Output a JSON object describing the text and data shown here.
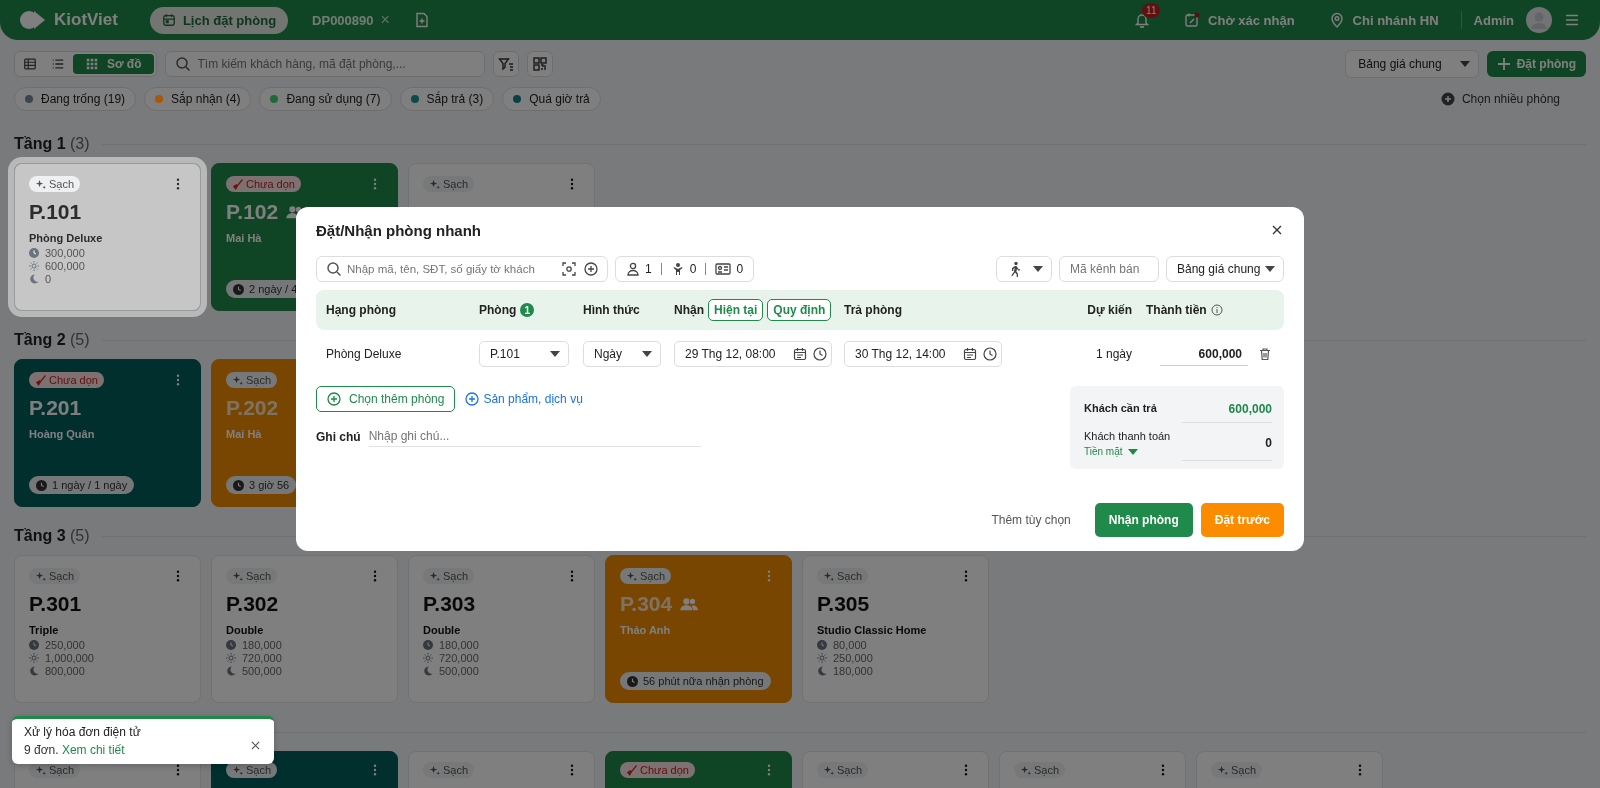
{
  "header": {
    "logo": "KiotViet",
    "tabs": [
      {
        "label": "Lịch đặt phòng",
        "kind": "calendar",
        "selected": true
      },
      {
        "label": "DP000890",
        "kind": "closable",
        "close": "×",
        "selected": false
      }
    ],
    "notification_count": "11",
    "pending": "Chờ xác nhận",
    "branch": "Chi nhánh HN",
    "user": "Admin"
  },
  "toolbar": {
    "views": [
      {
        "kind": "table",
        "selected": false
      },
      {
        "kind": "list",
        "selected": false
      },
      {
        "kind": "grid",
        "label": "Sơ đồ",
        "selected": true
      }
    ],
    "search": {
      "placeholder": "Tìm kiếm khách hàng, mã đặt phòng,..."
    },
    "price_list": "Bảng giá chung",
    "add_button": "Đặt phòng"
  },
  "filters": [
    {
      "label": "Đang trống (19)",
      "color": "#3d4450"
    },
    {
      "label": "Sắp nhận (4)",
      "color": "#a8580a"
    },
    {
      "label": "Đang sử dụng (7)",
      "color": "#1d6b3a"
    },
    {
      "label": "Sắp trả (3)",
      "color": "#0e4a4a"
    },
    {
      "label": "Quá giờ trả",
      "color": "#0b3f44"
    }
  ],
  "multi_select": "Chọn nhiều phòng",
  "floors": [
    {
      "name": "Tầng 1",
      "count": "(3)",
      "rooms": [
        {
          "kind": "vacant",
          "selected": true,
          "status": {
            "kind": "clean",
            "label": "Sạch"
          },
          "code": "P.101",
          "guests": false,
          "name": "Phòng Deluxe",
          "prices": [
            {
              "kind": "hour",
              "value": "300,000"
            },
            {
              "kind": "day",
              "value": "600,000"
            },
            {
              "kind": "night",
              "value": "0"
            }
          ]
        },
        {
          "kind": "occupied",
          "selected": false,
          "status": {
            "kind": "dirty",
            "label": "Chưa dọn"
          },
          "code": "P.102",
          "guests": true,
          "name": "Mai Hà",
          "pill": "2 ngày / 4"
        },
        {
          "kind": "vacant",
          "selected": false,
          "status": {
            "kind": "clean",
            "label": "Sạch"
          }
        }
      ]
    },
    {
      "name": "Tầng 2",
      "count": "(5)",
      "rooms": [
        {
          "kind": "checkout",
          "selected": false,
          "status": {
            "kind": "dirty",
            "label": "Chưa dọn"
          },
          "code": "P.201",
          "guests": false,
          "name": "Hoàng Quân",
          "pill": "1 ngày / 1 ngày"
        },
        {
          "kind": "arriving",
          "selected": false,
          "status": {
            "kind": "clean",
            "label": "Sạch"
          },
          "code": "P.202",
          "guests": false,
          "name": "Mai Hà",
          "pill": "3 giờ 56"
        }
      ]
    },
    {
      "name": "Tầng 3",
      "count": "(5)",
      "rooms": [
        {
          "kind": "vacant",
          "selected": false,
          "status": {
            "kind": "clean",
            "label": "Sạch"
          },
          "code": "P.301",
          "guests": false,
          "name": "Triple",
          "prices": [
            {
              "kind": "hour",
              "value": "250,000"
            },
            {
              "kind": "day",
              "value": "1,000,000"
            },
            {
              "kind": "night",
              "value": "800,000"
            }
          ]
        },
        {
          "kind": "vacant",
          "selected": false,
          "status": {
            "kind": "clean",
            "label": "Sạch"
          },
          "code": "P.302",
          "guests": false,
          "name": "Double",
          "prices": [
            {
              "kind": "hour",
              "value": "180,000"
            },
            {
              "kind": "day",
              "value": "720,000"
            },
            {
              "kind": "night",
              "value": "500,000"
            }
          ]
        },
        {
          "kind": "vacant",
          "selected": false,
          "status": {
            "kind": "clean",
            "label": "Sạch"
          },
          "code": "P.303",
          "guests": false,
          "name": "Double",
          "prices": [
            {
              "kind": "hour",
              "value": "180,000"
            },
            {
              "kind": "day",
              "value": "720,000"
            },
            {
              "kind": "night",
              "value": "500,000"
            }
          ]
        },
        {
          "kind": "arriving",
          "selected": false,
          "status": {
            "kind": "clean",
            "label": "Sạch"
          },
          "code": "P.304",
          "guests": true,
          "name": "Thảo Anh",
          "pill": "56 phút nữa nhận phòng"
        },
        {
          "kind": "vacant",
          "selected": false,
          "status": {
            "kind": "clean",
            "label": "Sạch"
          },
          "code": "P.305",
          "guests": false,
          "name": "Studio Classic Home",
          "prices": [
            {
              "kind": "hour",
              "value": "80,000"
            },
            {
              "kind": "day",
              "value": "250,000"
            },
            {
              "kind": "night",
              "value": "180,000"
            }
          ]
        }
      ]
    },
    {
      "rooms": [
        {
          "kind": "vacant",
          "selected": false,
          "status": {
            "kind": "clean",
            "label": "Sạch"
          }
        },
        {
          "kind": "checkout",
          "selected": false,
          "status": {
            "kind": "clean",
            "label": "Sạch"
          }
        },
        {
          "kind": "vacant",
          "selected": false,
          "status": {
            "kind": "clean",
            "label": "Sạch"
          }
        },
        {
          "kind": "occupied",
          "selected": false,
          "status": {
            "kind": "dirty",
            "label": "Chưa dọn"
          }
        },
        {
          "kind": "vacant",
          "selected": false,
          "status": {
            "kind": "clean",
            "label": "Sạch"
          }
        },
        {
          "kind": "vacant",
          "selected": false,
          "status": {
            "kind": "clean",
            "label": "Sạch"
          }
        },
        {
          "kind": "vacant",
          "selected": false,
          "status": {
            "kind": "clean",
            "label": "Sạch"
          }
        }
      ]
    }
  ],
  "modal": {
    "title": "Đặt/Nhận phòng nhanh",
    "customer_search": {
      "placeholder": "Nhập mã, tên, SĐT, số giấy tờ khách"
    },
    "counters": [
      {
        "kind": "adult",
        "value": "1"
      },
      {
        "kind": "child",
        "value": "0"
      },
      {
        "kind": "id",
        "value": "0"
      }
    ],
    "channel": {
      "placeholder": "Mã kênh bán"
    },
    "price_list": "Bảng giá chung",
    "columns": [
      {
        "label": "Hạng phòng"
      },
      {
        "label": "Phòng",
        "badge": "1"
      },
      {
        "label": "Hình thức"
      },
      {
        "label": "Nhận",
        "options": [
          "Hiện tại",
          "Quy định"
        ]
      },
      {
        "label": "Trả phòng"
      },
      {
        "label": "Dự kiến"
      },
      {
        "label": "Thành tiền",
        "info": true
      }
    ],
    "rows": [
      {
        "room_type": "Phòng Deluxe",
        "room": "P.101",
        "mode": "Ngày",
        "check_in": "29 Thg 12, 08:00",
        "check_out": "30 Thg 12, 14:00",
        "duration": "1 ngày",
        "amount": "600,000"
      }
    ],
    "add_room": "Chọn thêm phòng",
    "add_service": "Sản phẩm, dịch vụ",
    "note": {
      "label": "Ghi chú",
      "placeholder": "Nhập ghi chú..."
    },
    "summary": {
      "due_label": "Khách cần trả",
      "due": "600,000",
      "paid_label": "Khách thanh toán",
      "paid": "0",
      "method": "Tiền mặt"
    },
    "more_options": "Thêm tùy chọn",
    "buttons": [
      {
        "label": "Nhận phòng",
        "kind": "primary"
      },
      {
        "label": "Đặt trước",
        "kind": "warning"
      }
    ]
  },
  "toast": {
    "title": "Xử lý hóa đơn điện tử",
    "text": "9 đơn.",
    "link": "Xem chi tiết"
  }
}
